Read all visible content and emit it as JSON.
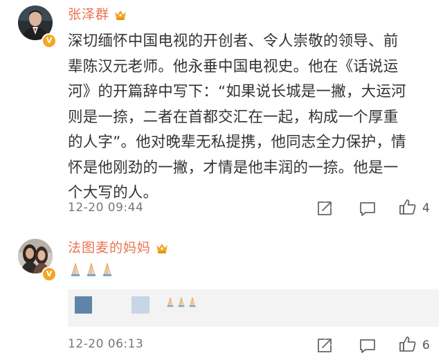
{
  "comments": [
    {
      "username": "张泽群",
      "verified_badge": "V",
      "avatar_icon": "avatar-man-in-suit",
      "lines": [
        "深切缅怀中国电视的开创者、令人崇敬的领导、前",
        "辈陈汉元老师。他永垂中国电视史。他在《话说运",
        "河》的开篇辞中写下：“如果说长城是一撇，大运河",
        "则是一捺，二者在首都交汇在一起，构成一个厚重",
        "的人字”。他对晚辈无私提携，他同志全力保护，情",
        "怀是他刚劲的一撇，才情是他丰润的一捺。他是一",
        "个大写的人。"
      ],
      "timestamp": "12-20 09:44",
      "like_count": "4"
    },
    {
      "username": "法图麦的妈妈",
      "verified_badge": "V",
      "avatar_icon": "avatar-two-women",
      "emoji_count": 3,
      "emoji": "folded-hands",
      "quoted_emoji_count": 3,
      "timestamp": "12-20 06:13",
      "like_count": "6"
    }
  ],
  "colors": {
    "username": "#eb7350",
    "badge": "#f5a623",
    "text": "#333333",
    "meta": "#777777",
    "quote_bg": "#f3f3f3"
  }
}
